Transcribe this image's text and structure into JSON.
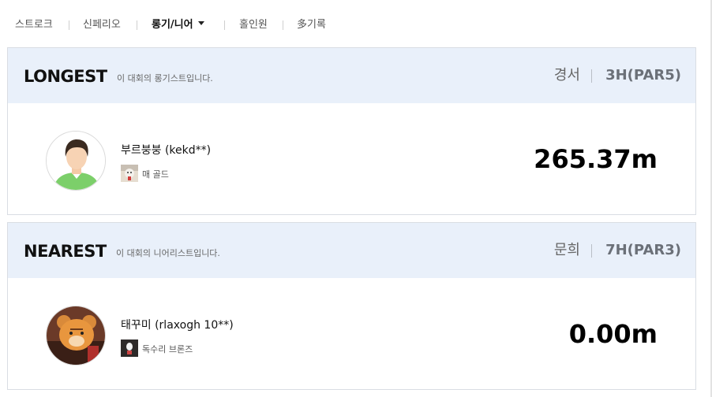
{
  "tabs": [
    {
      "label": "스트로크",
      "active": false
    },
    {
      "label": "신페리오",
      "active": false
    },
    {
      "label": "롱기/니어",
      "active": true
    },
    {
      "label": "홀인원",
      "active": false
    },
    {
      "label": "多기록",
      "active": false
    }
  ],
  "longest": {
    "title": "LONGEST",
    "description": "이 대회의 롱기스트입니다.",
    "course": "경서",
    "hole": "3H(PAR5)",
    "player_name": "부르붕붕 (kekd**)",
    "level_label": "매 골드",
    "distance": "265.37m"
  },
  "nearest": {
    "title": "NEAREST",
    "description": "이 대회의 니어리스트입니다.",
    "course": "문희",
    "hole": "7H(PAR3)",
    "player_name": "태꾸미 (rlaxogh 10**)",
    "level_label": "독수리 브론즈",
    "distance": "0.00m"
  },
  "colors": {
    "header_bg": "#e9f0fa",
    "card_border": "#d9dde3",
    "hole_text": "#6b7078"
  }
}
